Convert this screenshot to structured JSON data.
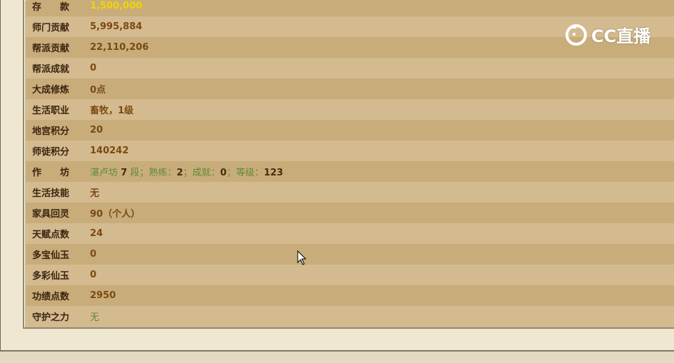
{
  "rows": [
    {
      "label": "存款",
      "value": "1,500,000"
    },
    {
      "label": "师门贡献",
      "value": "5,995,884"
    },
    {
      "label": "帮派贡献",
      "value": "22,110,206"
    },
    {
      "label": "帮派成就",
      "value": "0"
    },
    {
      "label": "大成修炼",
      "value": "0点"
    },
    {
      "label": "生活职业",
      "value": "畜牧，1级"
    },
    {
      "label": "地宫积分",
      "value": "20"
    },
    {
      "label": "师徒积分",
      "value": "140242"
    },
    {
      "label": "作坊",
      "value_parts": [
        "湛卢坊 ",
        "7",
        " 段；熟练：",
        "2",
        "；成就：",
        "0",
        "；等级：",
        "123"
      ]
    },
    {
      "label": "生活技能",
      "value": "无"
    },
    {
      "label": "家具回灵",
      "value": "90（个人）"
    },
    {
      "label": "天赋点数",
      "value": "24"
    },
    {
      "label": "多宝仙玉",
      "value": "0"
    },
    {
      "label": "多彩仙玉",
      "value": "0"
    },
    {
      "label": "功绩点数",
      "value": "2950"
    },
    {
      "label": "守护之力",
      "value": "无"
    }
  ],
  "watermark": {
    "text": "CC直播"
  },
  "colors": {
    "label": "#3b2410",
    "value": "#7a4a12",
    "highlight": "#f2d400",
    "green": "#5d8a3a"
  }
}
